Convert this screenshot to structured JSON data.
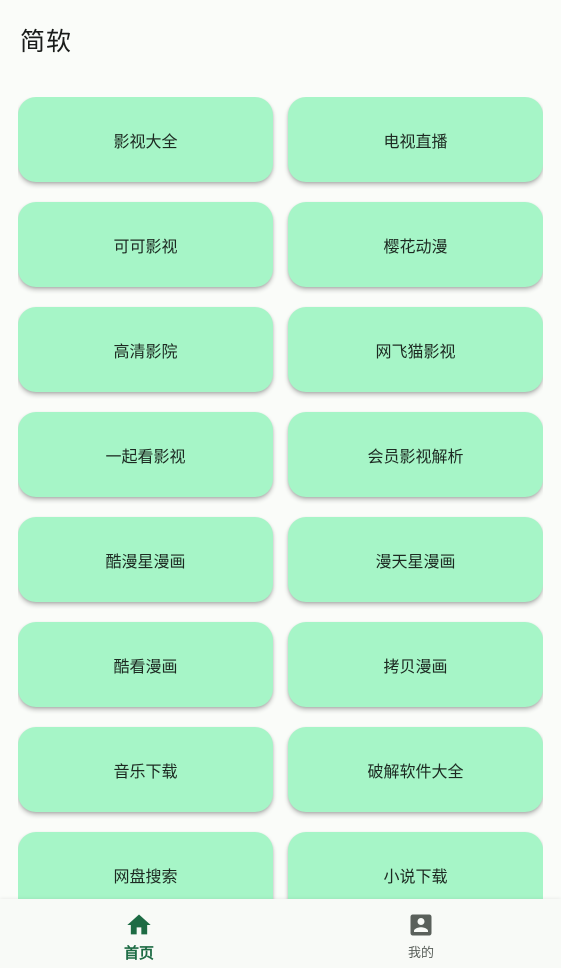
{
  "app": {
    "title": "简软"
  },
  "grid": {
    "items": [
      {
        "label": "影视大全"
      },
      {
        "label": "电视直播"
      },
      {
        "label": "可可影视"
      },
      {
        "label": "樱花动漫"
      },
      {
        "label": "高清影院"
      },
      {
        "label": "网飞猫影视"
      },
      {
        "label": "一起看影视"
      },
      {
        "label": "会员影视解析"
      },
      {
        "label": "酷漫星漫画"
      },
      {
        "label": "漫天星漫画"
      },
      {
        "label": "酷看漫画"
      },
      {
        "label": "拷贝漫画"
      },
      {
        "label": "音乐下载"
      },
      {
        "label": "破解软件大全"
      },
      {
        "label": "网盘搜索"
      },
      {
        "label": "小说下载"
      }
    ]
  },
  "bottom_nav": {
    "home": {
      "label": "首页",
      "icon": "home-icon",
      "active": true
    },
    "mine": {
      "label": "我的",
      "icon": "account-box-icon",
      "active": false
    }
  },
  "colors": {
    "tile_bg": "#a6f5c7",
    "accent": "#1d6b44",
    "inactive": "#5a605b",
    "background": "#fafcf9"
  }
}
